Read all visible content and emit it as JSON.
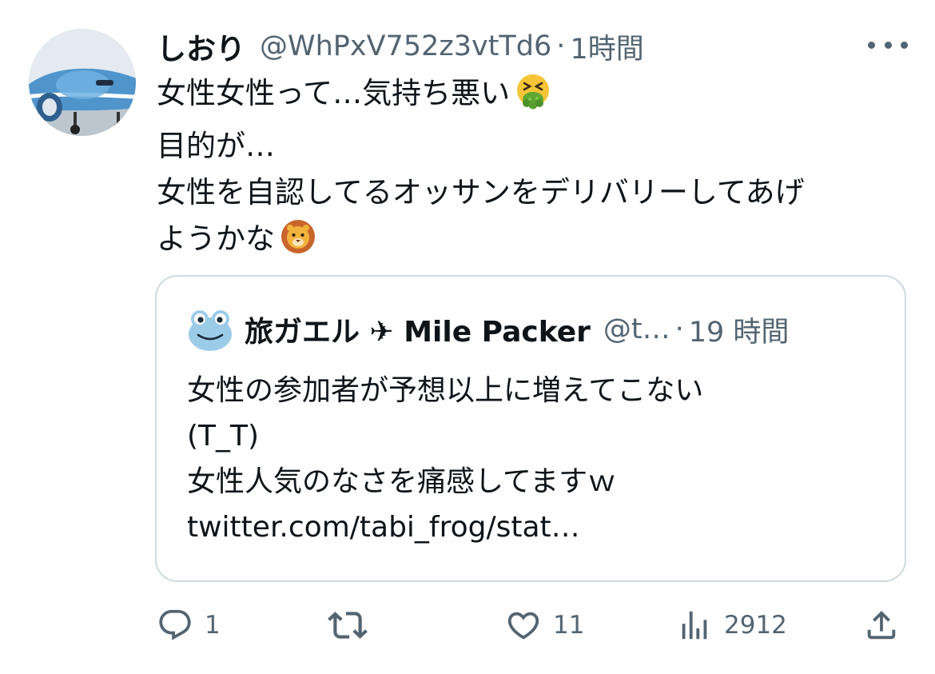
{
  "tweet": {
    "author_name": "しおり",
    "handle": "@WhPxV752z3vtTd6",
    "separator": "·",
    "time": "1時間",
    "more_icon": "more-horizontal-icon",
    "avatar_icon": "airplane-photo-avatar",
    "body_lines": [
      "女性女性って…気持ち悪い",
      "目的が…",
      "女性を自認してるオッサンをデリバリーしてあげ",
      "ようかな"
    ],
    "emoji_1": "nauseated-face-emoji",
    "emoji_2": "lion-face-emoji"
  },
  "quote": {
    "avatar_icon": "frog-face-icon",
    "author_name": "旅ガエル ✈ Mile Packer",
    "handle": "@t…",
    "separator": "·",
    "time": "19 時間",
    "body_lines": [
      "女性の参加者が予想以上に増えてこない",
      "(T_T)",
      "女性人気のなさを痛感してますｗ",
      "twitter.com/tabi_frog/stat…"
    ]
  },
  "actions": {
    "reply": {
      "icon": "reply-icon",
      "count": "1"
    },
    "retweet": {
      "icon": "retweet-icon",
      "count": ""
    },
    "like": {
      "icon": "heart-icon",
      "count": "11"
    },
    "views": {
      "icon": "views-chart-icon",
      "count": "2912"
    },
    "share": {
      "icon": "share-icon",
      "count": ""
    }
  },
  "colors": {
    "primary_text": "#0f1419",
    "secondary_text": "#536471",
    "border": "#cfd9de"
  }
}
